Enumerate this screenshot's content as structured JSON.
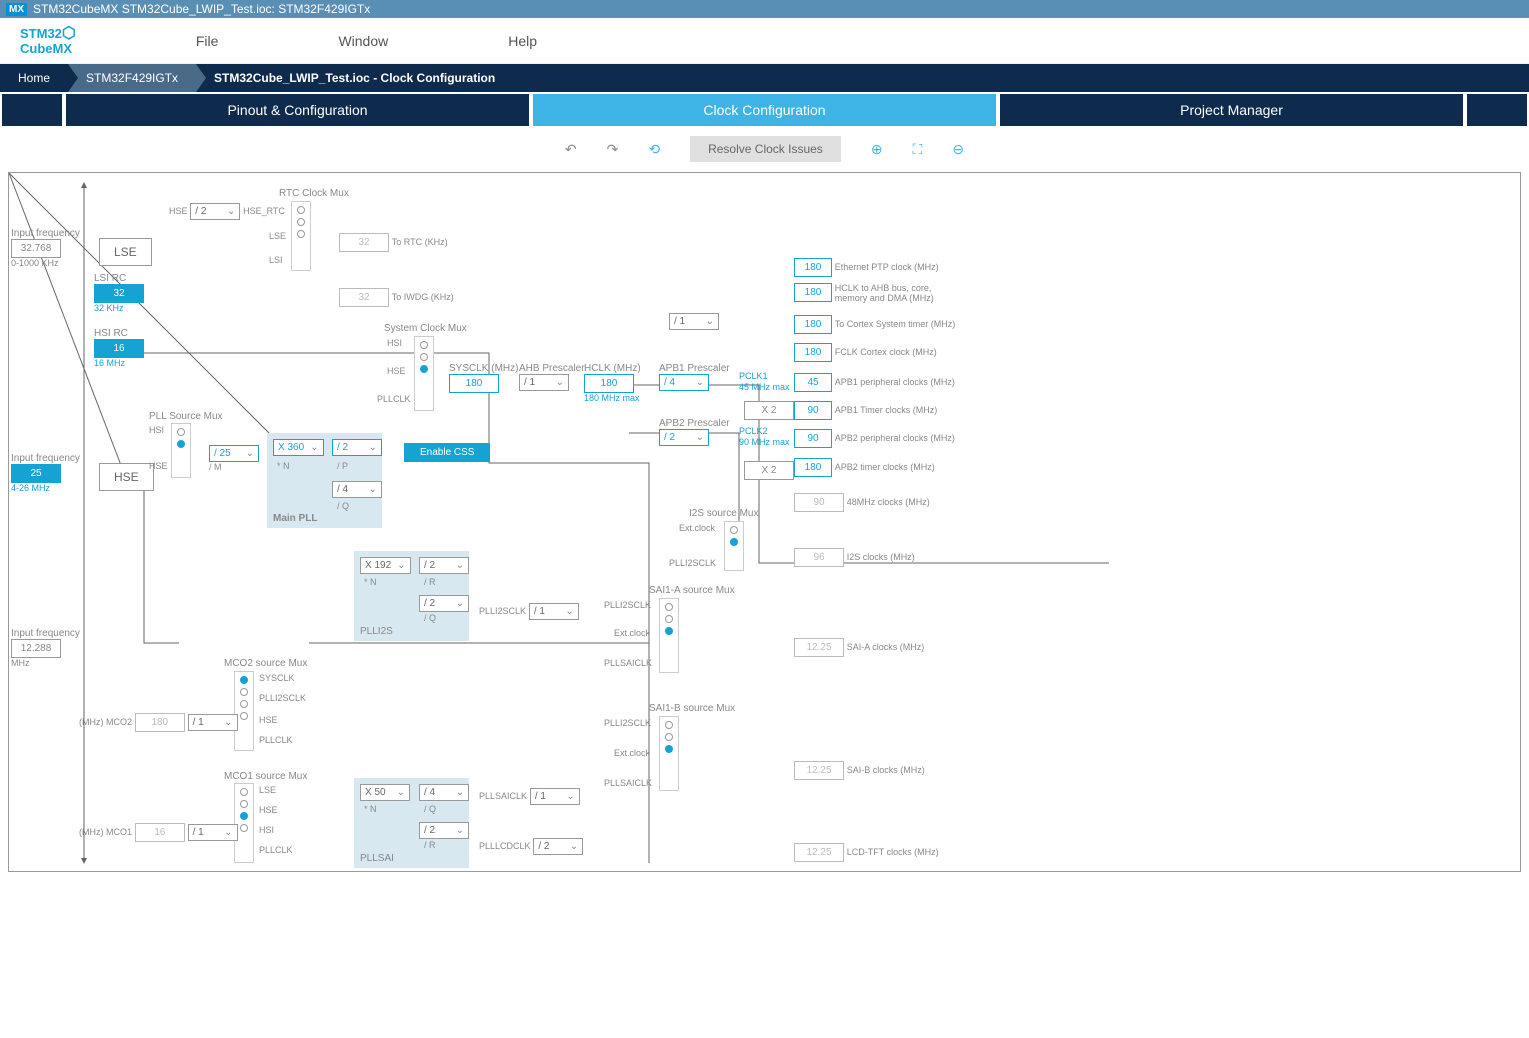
{
  "title": "STM32CubeMX STM32Cube_LWIP_Test.ioc: STM32F429IGTx",
  "logo_top": "STM32",
  "logo_bot": "CubeMX",
  "menu": {
    "file": "File",
    "window": "Window",
    "help": "Help"
  },
  "bc": {
    "home": "Home",
    "chip": "STM32F429IGTx",
    "file": "STM32Cube_LWIP_Test.ioc - Clock Configuration"
  },
  "tabs": {
    "pinout": "Pinout & Configuration",
    "clock": "Clock Configuration",
    "pm": "Project Manager"
  },
  "toolbar": {
    "resolve": "Resolve Clock Issues"
  },
  "freq": {
    "lse_lbl": "Input frequency",
    "lse": "32.768",
    "lse_rng": "0-1000 KHz",
    "hse_lbl": "Input frequency",
    "hse": "25",
    "hse_rng": "4-26 MHz",
    "i2s_lbl": "Input frequency",
    "i2s": "12.288",
    "i2s_unit": "MHz"
  },
  "osc": {
    "lse": "LSE",
    "lsi": "LSI RC",
    "lsi_v": "32",
    "lsi_sub": "32 KHz",
    "hsi": "HSI RC",
    "hsi_v": "16",
    "hsi_sub": "16 MHz",
    "hse": "HSE"
  },
  "rtc": {
    "title": "RTC Clock Mux",
    "hse": "HSE",
    "div": "/ 2",
    "hse_rtc": "HSE_RTC",
    "lse": "LSE",
    "lsi": "LSI",
    "out": "32",
    "out_lbl": "To RTC (KHz)"
  },
  "iwdg": {
    "out": "32",
    "lbl": "To IWDG (KHz)"
  },
  "pllsrc": {
    "title": "PLL Source Mux",
    "hsi": "HSI",
    "hse": "HSE"
  },
  "pllm": {
    "v": "/ 25",
    "lbl": "/ M"
  },
  "mainpll": {
    "title": "Main PLL",
    "n": "X 360",
    "n_lbl": "* N",
    "p": "/ 2",
    "p_lbl": "/ P",
    "q": "/ 4",
    "q_lbl": "/ Q"
  },
  "sysmux": {
    "title": "System Clock Mux",
    "hsi": "HSI",
    "hse": "HSE",
    "pllclk": "PLLCLK"
  },
  "css": "Enable CSS",
  "sysclk": {
    "lbl": "SYSCLK (MHz)",
    "v": "180"
  },
  "ahb": {
    "lbl": "AHB Prescaler",
    "v": "/ 1"
  },
  "hclk": {
    "lbl": "HCLK (MHz)",
    "v": "180",
    "max": "180 MHz max"
  },
  "apb1": {
    "lbl": "APB1 Prescaler",
    "v": "/ 4",
    "pclk": "PCLK1",
    "max": "45 MHz max",
    "x2": "X 2"
  },
  "apb2": {
    "lbl": "APB2 Prescaler",
    "v": "/ 2",
    "pclk": "PCLK2",
    "max": "90 MHz max",
    "x2": "X 2"
  },
  "cortex": {
    "v": "/ 1"
  },
  "outputs": {
    "eth": {
      "v": "180",
      "lbl": "Ethernet PTP clock (MHz)"
    },
    "hclk": {
      "v": "180",
      "lbl": "HCLK to AHB bus, core, memory and DMA (MHz)"
    },
    "cortex": {
      "v": "180",
      "lbl": "To Cortex System timer (MHz)"
    },
    "fclk": {
      "v": "180",
      "lbl": "FCLK Cortex clock (MHz)"
    },
    "apb1p": {
      "v": "45",
      "lbl": "APB1 peripheral clocks (MHz)"
    },
    "apb1t": {
      "v": "90",
      "lbl": "APB1 Timer clocks (MHz)"
    },
    "apb2p": {
      "v": "90",
      "lbl": "APB2 peripheral clocks (MHz)"
    },
    "apb2t": {
      "v": "180",
      "lbl": "APB2 timer clocks (MHz)"
    },
    "mhz48": {
      "v": "90",
      "lbl": "48MHz clocks (MHz)"
    },
    "i2s": {
      "v": "96",
      "lbl": "I2S clocks (MHz)"
    },
    "saia": {
      "v": "12.25",
      "lbl": "SAI-A clocks (MHz)"
    },
    "saib": {
      "v": "12.25",
      "lbl": "SAI-B clocks (MHz)"
    },
    "lcd": {
      "v": "12.25",
      "lbl": "LCD-TFT clocks (MHz)"
    }
  },
  "i2smux": {
    "title": "I2S source Mux",
    "ext": "Ext.clock",
    "plli2s": "PLLI2SCLK"
  },
  "plli2s": {
    "title": "PLLI2S",
    "n": "X 192",
    "n_lbl": "* N",
    "r": "/ 2",
    "r_lbl": "/ R",
    "q": "/ 2",
    "q_lbl": "/ Q"
  },
  "plli2s_div": {
    "lbl": "PLLI2SCLK",
    "v": "/ 1"
  },
  "saia": {
    "title": "SAI1-A source Mux",
    "plli2s": "PLLI2SCLK",
    "ext": "Ext.clock",
    "pllsai": "PLLSAICLK"
  },
  "saib": {
    "title": "SAI1-B source Mux",
    "plli2s": "PLLI2SCLK",
    "ext": "Ext.clock",
    "pllsai": "PLLSAICLK"
  },
  "pllsai": {
    "title": "PLLSAI",
    "n": "X 50",
    "n_lbl": "* N",
    "q": "/ 4",
    "q_lbl": "/ Q",
    "r": "/ 2",
    "r_lbl": "/ R"
  },
  "pllsai_div": {
    "lbl": "PLLSAICLK",
    "v": "/ 1"
  },
  "pllcd_div": {
    "lbl": "PLLLCDCLK",
    "v": "/ 2"
  },
  "mco2": {
    "title": "MCO2 source Mux",
    "sysclk": "SYSCLK",
    "plli2s": "PLLI2SCLK",
    "hse": "HSE",
    "pllclk": "PLLCLK",
    "out_lbl": "(MHz) MCO2",
    "out": "180",
    "div": "/ 1"
  },
  "mco1": {
    "title": "MCO1 source Mux",
    "lse": "LSE",
    "hse": "HSE",
    "hsi": "HSI",
    "pllclk": "PLLCLK",
    "out_lbl": "(MHz) MCO1",
    "out": "16",
    "div": "/ 1"
  }
}
